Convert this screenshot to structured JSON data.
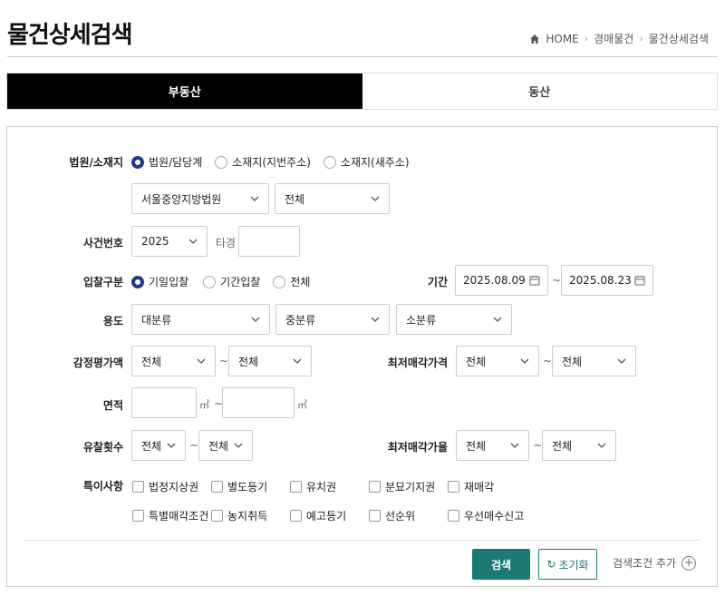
{
  "page": {
    "title": "물건상세검색"
  },
  "breadcrumb": [
    "HOME",
    "경매물건",
    "물건상세검색"
  ],
  "tabs": [
    {
      "label": "부동산",
      "active": true
    },
    {
      "label": "동산",
      "active": false
    }
  ],
  "form": {
    "court": {
      "label": "법원/소재지",
      "radios": [
        {
          "label": "법원/담당계",
          "checked": true
        },
        {
          "label": "소재지(지번주소)",
          "checked": false
        },
        {
          "label": "소재지(새주소)",
          "checked": false
        }
      ],
      "court_select": "서울중앙지방법원",
      "dept_select": "전체"
    },
    "case": {
      "label": "사건번호",
      "year": "2025",
      "suffix": "타경",
      "number": ""
    },
    "bid_type": {
      "label": "입찰구분",
      "radios": [
        {
          "label": "기일입찰",
          "checked": true
        },
        {
          "label": "기간입찰",
          "checked": false
        },
        {
          "label": "전체",
          "checked": false
        }
      ]
    },
    "period": {
      "label": "기간",
      "from": "2025.08.09",
      "to": "2025.08.23"
    },
    "usage": {
      "label": "용도",
      "major": "대분류",
      "middle": "중분류",
      "minor": "소분류"
    },
    "appraisal": {
      "label": "감정평가액",
      "from": "전체",
      "to": "전체"
    },
    "min_price": {
      "label": "최저매각가격",
      "from": "전체",
      "to": "전체"
    },
    "area": {
      "label": "면적",
      "unit": "㎡",
      "from": "",
      "to": ""
    },
    "fail_count": {
      "label": "유찰횟수",
      "from": "전체",
      "to": "전체"
    },
    "min_rate": {
      "label": "최저매각가율",
      "from": "전체",
      "to": "전체"
    },
    "special": {
      "label": "특이사항",
      "row1": [
        "법정지상권",
        "별도등기",
        "유치권",
        "분묘기지권",
        "재매각"
      ],
      "row2": [
        "특별매각조건",
        "농지취득",
        "예고등기",
        "선순위",
        "우선매수신고"
      ]
    },
    "tilde": "~"
  },
  "actions": {
    "search": "검색",
    "reset": "초기화",
    "add_condition": "검색조건 추가"
  },
  "colors": {
    "accent": "#1c7a75",
    "radio_on": "#1f3a8a",
    "tab_active_bg": "#000000"
  }
}
